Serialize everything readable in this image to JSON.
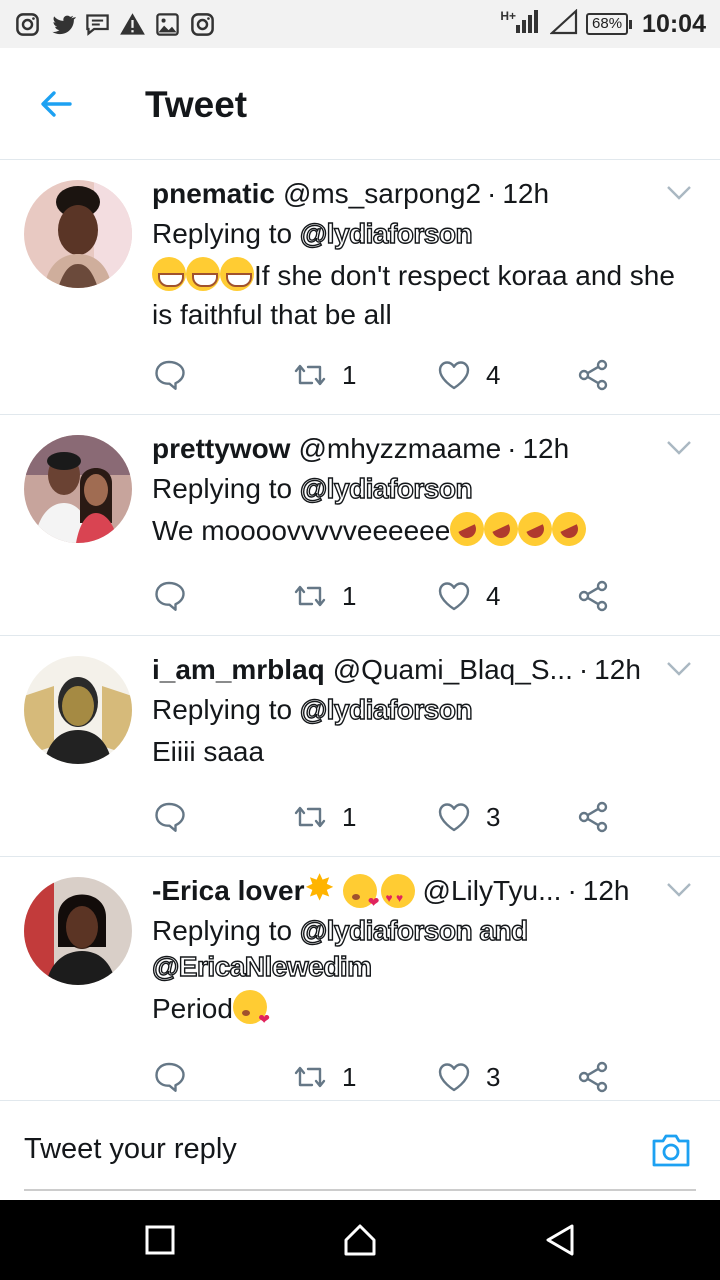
{
  "status_bar": {
    "icons": [
      "instagram-icon",
      "twitter-icon",
      "message-icon",
      "warning-icon",
      "image-icon",
      "instagram-icon"
    ],
    "network": "H+",
    "battery": "68%",
    "time": "10:04"
  },
  "header": {
    "title": "Tweet"
  },
  "tweets": [
    {
      "name": "pnematic",
      "handle": "@ms_sarpong2",
      "time": "12h",
      "replying_prefix": "Replying to",
      "mentions": "@lydiaforson",
      "mentions2": "",
      "text": "If she don't respect koraa and she is faithful that be all",
      "retweets": "1",
      "likes": "4"
    },
    {
      "name": "prettywow",
      "handle": "@mhyzzmaame",
      "time": "12h",
      "replying_prefix": "Replying to",
      "mentions": "@lydiaforson",
      "mentions2": "",
      "text": "We moooovvvvveeeeee",
      "retweets": "1",
      "likes": "4"
    },
    {
      "name": "i_am_mrblaq",
      "handle": "@Quami_Blaq_S...",
      "time": "12h",
      "replying_prefix": "Replying to",
      "mentions": "@lydiaforson",
      "mentions2": "",
      "text": "Eiiii saaa",
      "retweets": "1",
      "likes": "3"
    },
    {
      "name": "-Erica lover",
      "handle": "@LilyTyu...",
      "time": "12h",
      "replying_prefix": "Replying to",
      "mentions": "@lydiaforson and",
      "mentions2": "@EricaNlewedim",
      "text": "Period",
      "retweets": "1",
      "likes": "3"
    }
  ],
  "reply_bar": {
    "placeholder": "Tweet your reply"
  },
  "colors": {
    "accent": "#1da1f2",
    "divider": "#e1e8ed",
    "icon_gray": "#657786"
  }
}
